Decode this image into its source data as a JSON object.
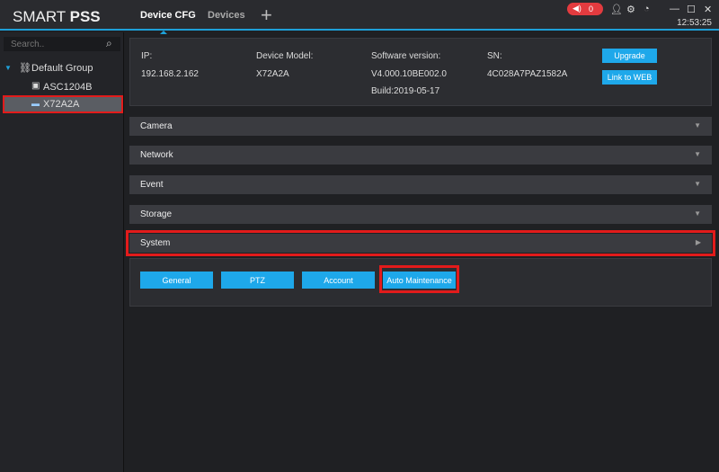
{
  "header": {
    "logo_light": "SMART ",
    "logo_bold": "PSS",
    "tabs": [
      "Device CFG",
      "Devices"
    ],
    "add": "+",
    "alarm_count": "0",
    "clock": "12:53:25"
  },
  "sidebar": {
    "search_placeholder": "Search..",
    "group": "Default Group",
    "devices": [
      "ASC1204B",
      "X72A2A"
    ]
  },
  "info": {
    "ip_label": "IP:",
    "ip": "192.168.2.162",
    "model_label": "Device Model:",
    "model": "X72A2A",
    "sw_label": "Software version:",
    "sw": "V4.000.10BE002.0",
    "build": "Build:2019-05-17",
    "sn_label": "SN:",
    "sn": "4C028A7PAZ1582A",
    "upgrade": "Upgrade",
    "link_web": "Link to WEB"
  },
  "sections": [
    "Camera",
    "Network",
    "Event",
    "Storage",
    "System"
  ],
  "system_buttons": [
    "General",
    "PTZ",
    "Account",
    "Auto Maintenance"
  ]
}
